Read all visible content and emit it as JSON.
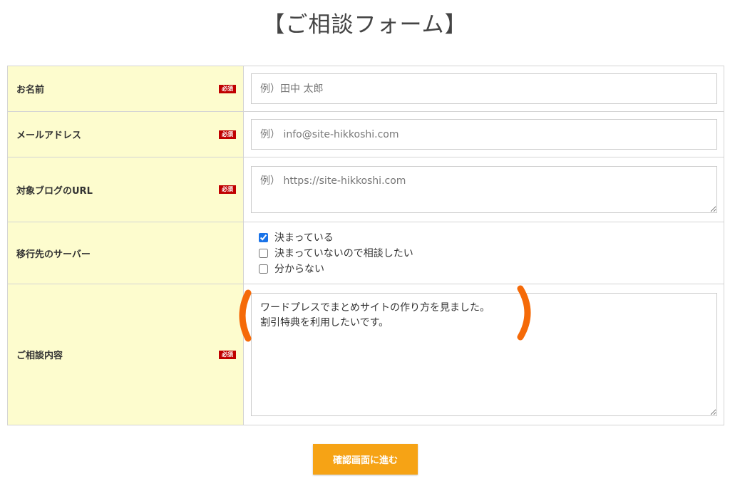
{
  "form": {
    "title": "【ご相談フォーム】",
    "required_label": "必須",
    "rows": {
      "name": {
        "label": "お名前",
        "placeholder": "例）田中 太郎",
        "value": ""
      },
      "email": {
        "label": "メールアドレス",
        "placeholder": "例） info@site-hikkoshi.com",
        "value": ""
      },
      "blog_url": {
        "label": "対象ブログのURL",
        "placeholder": "例） https://site-hikkoshi.com",
        "value": ""
      },
      "server": {
        "label": "移行先のサーバー",
        "options": [
          {
            "label": "決まっている",
            "checked": true
          },
          {
            "label": "決まっていないので相談したい",
            "checked": false
          },
          {
            "label": "分からない",
            "checked": false
          }
        ]
      },
      "consultation": {
        "label": "ご相談内容",
        "value": "ワードプレスでまとめサイトの作り方を見ました。\n割引特典を利用したいです。"
      }
    },
    "submit_label": "確認画面に進む"
  },
  "colors": {
    "label_background": "#fdfcce",
    "required_badge": "#c00000",
    "submit_button": "#f6a315",
    "annotation_bracket": "#f56a08"
  }
}
